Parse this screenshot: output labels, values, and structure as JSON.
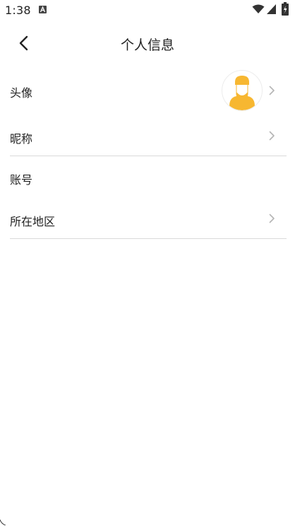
{
  "status_bar": {
    "time": "1:38",
    "icons": [
      "a-icon",
      "wifi-icon",
      "signal-icon",
      "battery-icon"
    ]
  },
  "header": {
    "title": "个人信息",
    "back_icon": "back-arrow-icon"
  },
  "profile": {
    "rows": [
      {
        "label": "头像",
        "has_chevron": true,
        "has_avatar": true
      },
      {
        "label": "昵称",
        "has_chevron": true
      },
      {
        "label": "账号",
        "has_chevron": false
      },
      {
        "label": "所在地区",
        "has_chevron": true
      }
    ],
    "avatar_icon": "default-user-avatar-icon"
  },
  "colors": {
    "text": "#222222",
    "chevron": "#b5b5b5",
    "divider": "#d9d9d9",
    "avatar_hair": "#f7b731",
    "avatar_body": "#f7b731"
  }
}
